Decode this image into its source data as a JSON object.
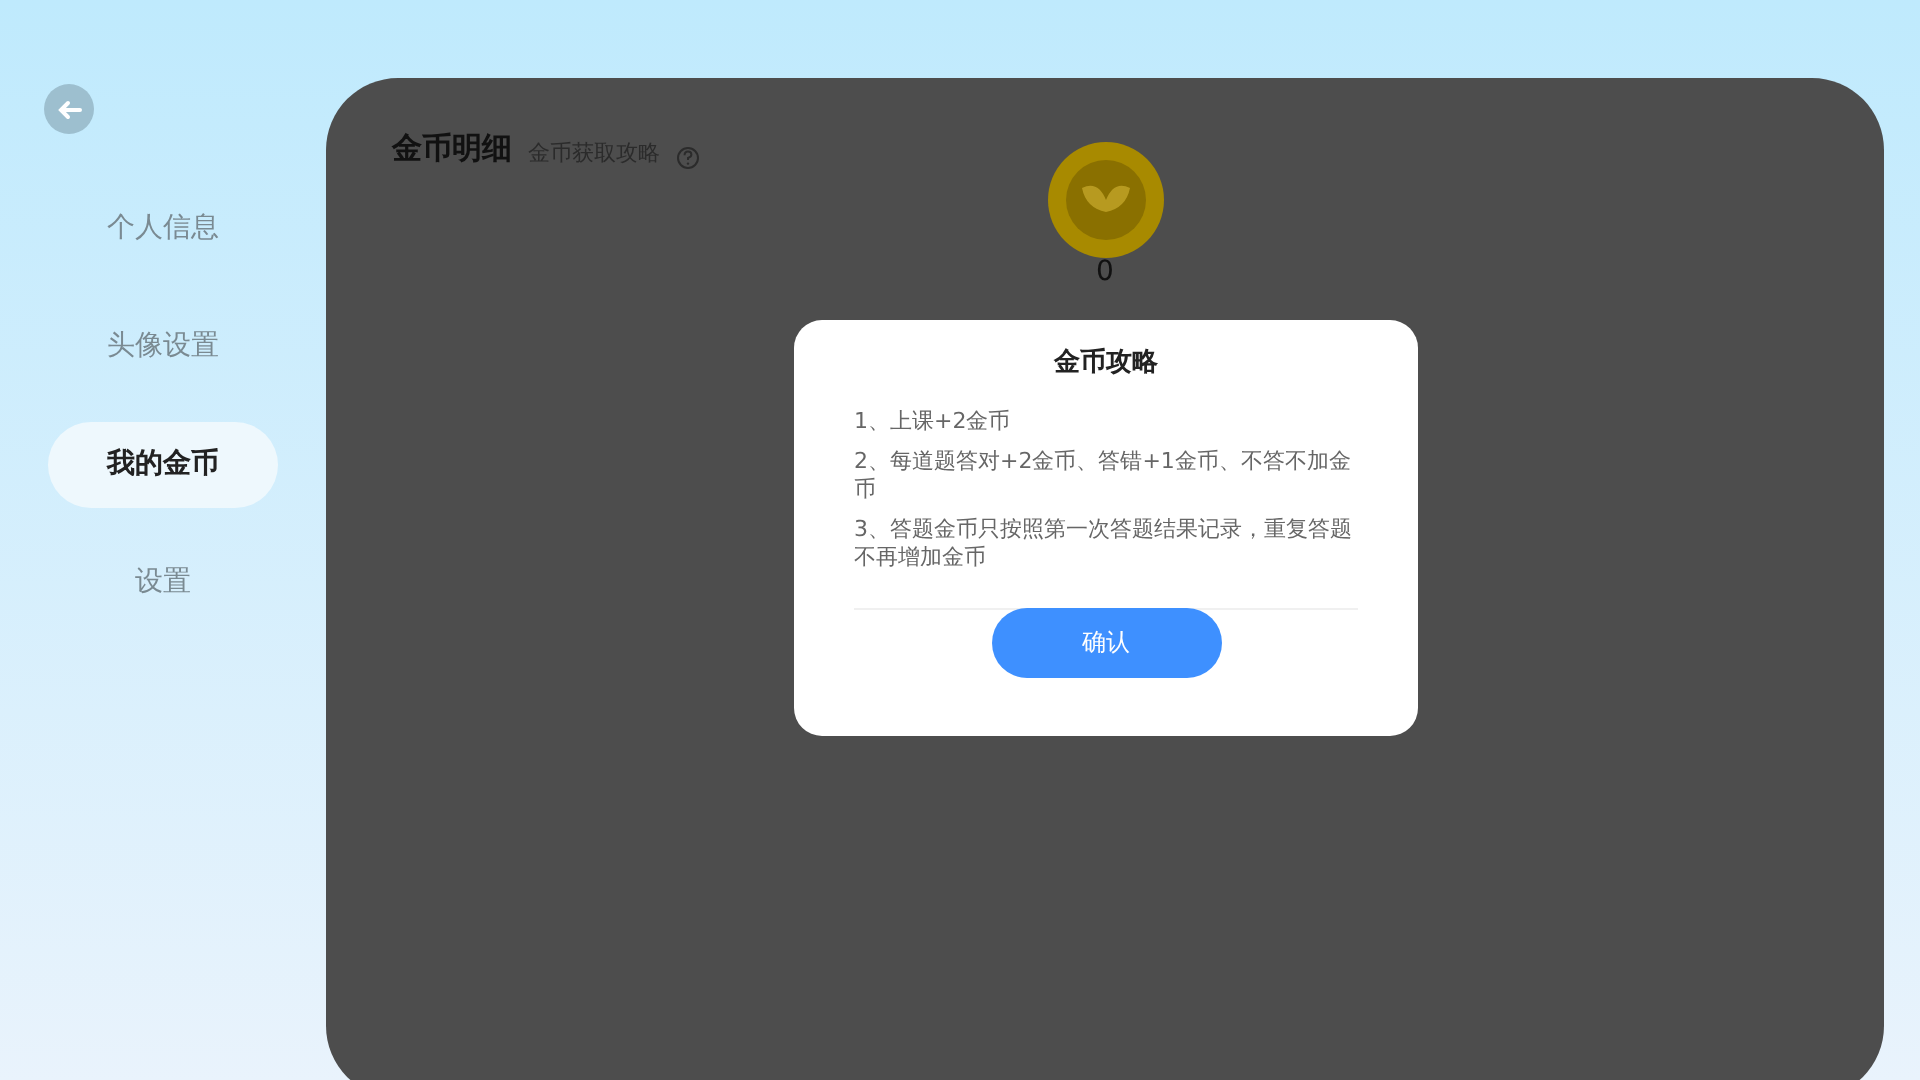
{
  "sidebar": {
    "items": [
      {
        "label": "个人信息",
        "selected": false
      },
      {
        "label": "头像设置",
        "selected": false
      },
      {
        "label": "我的金币",
        "selected": true
      },
      {
        "label": "设置",
        "selected": false
      }
    ]
  },
  "panel": {
    "title": "金币明细",
    "link": "金币获取攻略",
    "coin_count": "0"
  },
  "dialog": {
    "title": "金币攻略",
    "rules": [
      "1、上课+2金币",
      "2、每道题答对+2金币、答错+1金币、不答不加金币",
      "3、答题金币只按照第一次答题结果记录，重复答题不再增加金币"
    ],
    "button": "确认"
  }
}
